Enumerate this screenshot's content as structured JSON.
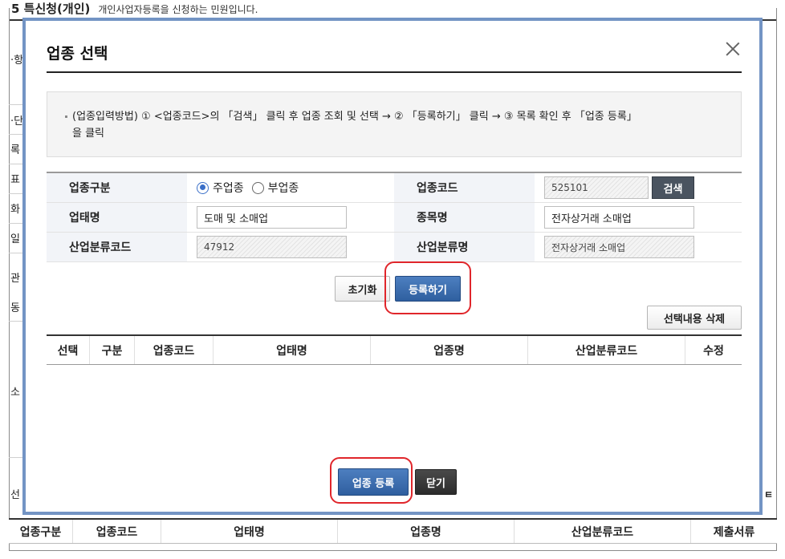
{
  "background": {
    "header_title": "5 특신청(개인)",
    "header_sub": "개인사업자등록을 신청하는 민원입니다.",
    "left_chars": [
      "·항",
      "",
      "·단",
      "록",
      "표",
      "화",
      "일",
      "관",
      "동",
      "소",
      "선"
    ],
    "right_char": "ㅌ",
    "table_headers": [
      "업종구분",
      "업종코드",
      "업태명",
      "업종명",
      "산업분류코드",
      "제출서류"
    ]
  },
  "modal": {
    "title": "업종 선택",
    "guide_text_line1": "(업종입력방법) ① <업종코드>의 「검색」 클릭 후 업종 조회 및 선택 → ② 「등록하기」 클릭 → ③ 목록 확인 후 「업종 등록」",
    "guide_text_line2": "을 클릭",
    "form": {
      "category_label": "업종구분",
      "radio_main": "주업종",
      "radio_sub": "부업종",
      "code_label": "업종코드",
      "code_value": "525101",
      "search_button": "검색",
      "business_type_label": "업태명",
      "business_type_value": "도매 및 소매업",
      "item_label": "종목명",
      "item_value": "전자상거래 소매업",
      "industry_code_label": "산업분류코드",
      "industry_code_value": "47912",
      "industry_name_label": "산업분류명",
      "industry_name_value": "전자상거래 소매업"
    },
    "reset_button": "초기화",
    "register_button": "등록하기",
    "delete_selected_button": "선택내용 삭제",
    "list_headers": [
      "선택",
      "구분",
      "업종코드",
      "업태명",
      "업종명",
      "산업분류코드",
      "수정"
    ],
    "submit_button": "업종 등록",
    "close_button": "닫기"
  }
}
